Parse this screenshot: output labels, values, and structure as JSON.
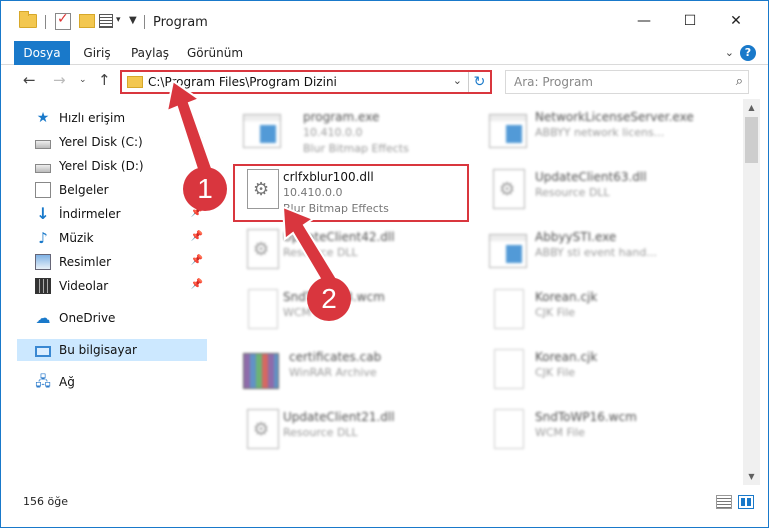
{
  "window": {
    "title": "Program",
    "minimize_icon": "minimize-icon",
    "maximize_icon": "maximize-icon",
    "close_icon": "close-icon"
  },
  "ribbon": {
    "tabs": [
      {
        "label": "Dosya"
      },
      {
        "label": "Giriş"
      },
      {
        "label": "Paylaş"
      },
      {
        "label": "Görünüm"
      }
    ],
    "help_label": "?"
  },
  "address": {
    "path": "C:\\Program Files\\Program Dizini"
  },
  "search": {
    "placeholder": "Ara: Program"
  },
  "sidebar": {
    "items": [
      {
        "label": "Hızlı erişim",
        "icon": "star-icon"
      },
      {
        "label": "Yerel Disk (C:)",
        "icon": "disk-icon"
      },
      {
        "label": "Yerel Disk (D:)",
        "icon": "disk-icon"
      },
      {
        "label": "Belgeler",
        "icon": "documents-icon"
      },
      {
        "label": "İndirmeler",
        "icon": "download-icon"
      },
      {
        "label": "Müzik",
        "icon": "music-icon"
      },
      {
        "label": "Resimler",
        "icon": "pictures-icon"
      },
      {
        "label": "Videolar",
        "icon": "videos-icon"
      },
      {
        "label": "OneDrive",
        "icon": "cloud-icon"
      },
      {
        "label": "Bu bilgisayar",
        "icon": "computer-icon"
      },
      {
        "label": "Ağ",
        "icon": "network-icon"
      }
    ]
  },
  "files": [
    {
      "name": "program.exe",
      "line2": "10.410.0.0",
      "line3": "Blur Bitmap Effects",
      "icon": "exe-icon"
    },
    {
      "name": "NetworkLicenseServer.exe",
      "line2": "ABBYY network licens...",
      "line3": "",
      "icon": "exe-icon"
    },
    {
      "name": "crlfxblur100.dll",
      "line2": "10.410.0.0",
      "line3": "Blur Bitmap Effects",
      "icon": "dll-icon"
    },
    {
      "name": "UpdateClient63.dll",
      "line2": "Resource DLL",
      "line3": "",
      "icon": "dll-icon"
    },
    {
      "name": "UpdateClient42.dll",
      "line2": "Resource DLL",
      "line3": "",
      "icon": "dll-icon"
    },
    {
      "name": "AbbyySTI.exe",
      "line2": "ABBY sti event hand...",
      "line3": "",
      "icon": "exe-icon"
    },
    {
      "name": "SndToWP13.wcm",
      "line2": "WCM File",
      "line3": "",
      "icon": "file-icon"
    },
    {
      "name": "Korean.cjk",
      "line2": "CJK File",
      "line3": "",
      "icon": "file-icon"
    },
    {
      "name": "certificates.cab",
      "line2": "WinRAR Archive",
      "line3": "",
      "icon": "archive-icon"
    },
    {
      "name": "Korean.cjk",
      "line2": "CJK File",
      "line3": "",
      "icon": "file-icon"
    },
    {
      "name": "UpdateClient21.dll",
      "line2": "Resource DLL",
      "line3": "",
      "icon": "dll-icon"
    },
    {
      "name": "SndToWP16.wcm",
      "line2": "WCM File",
      "line3": "",
      "icon": "file-icon"
    }
  ],
  "status": {
    "count_text": "156 öğe"
  },
  "annotations": {
    "step1": "1",
    "step2": "2",
    "color": "#d9363e"
  },
  "colors": {
    "accent": "#1979ca",
    "highlight": "#d9363e",
    "selected_bg": "#cce8ff"
  }
}
